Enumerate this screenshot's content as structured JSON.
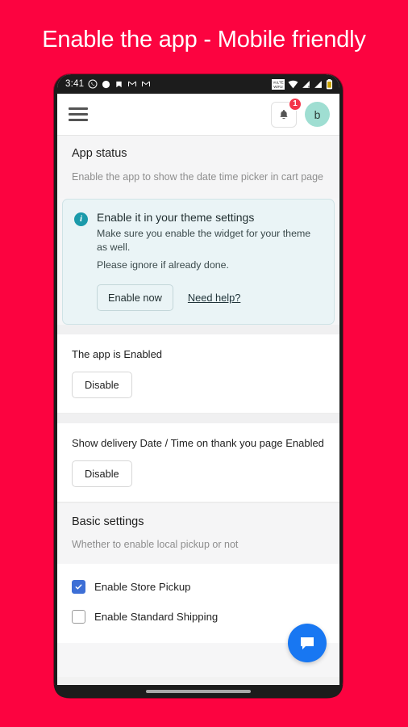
{
  "promo": {
    "title": "Enable the app - Mobile friendly",
    "background_color": "#fc0340",
    "text_color": "#ffffff"
  },
  "statusbar": {
    "time": "3:41",
    "left_icons": [
      "whatsapp-icon",
      "circle-icon",
      "bookmark-icon",
      "gmail-icon",
      "gmail-icon"
    ],
    "right_icons": [
      "volte-wifi-icon",
      "wifi-icon",
      "signal-roaming-icon",
      "signal-icon",
      "battery-icon"
    ]
  },
  "appbar": {
    "menu_icon": "hamburger-menu-icon",
    "bell_icon": "notification-bell-icon",
    "badge_count": "1",
    "avatar_initial": "b",
    "avatar_color": "#9fded2"
  },
  "app_status": {
    "heading": "App status",
    "description": "Enable the app to show the date time picker in cart page"
  },
  "info_banner": {
    "icon": "info-circle-icon",
    "icon_color": "#1b9aaa",
    "title": "Enable it in your theme settings",
    "line1": "Make sure you enable the widget for your theme as well.",
    "line2": "Please ignore if already done.",
    "primary_button": "Enable now",
    "help_link": "Need help?"
  },
  "rows": [
    {
      "label": "The app is Enabled",
      "button": "Disable"
    },
    {
      "label": "Show delivery Date / Time on thank you page Enabled",
      "button": "Disable"
    }
  ],
  "basic_settings": {
    "heading": "Basic settings",
    "description": "Whether to enable local pickup or not",
    "options": [
      {
        "label": "Enable Store Pickup",
        "checked": true
      },
      {
        "label": "Enable Standard Shipping",
        "checked": false
      }
    ],
    "checked_color": "#3d6fd6"
  },
  "chat_fab": {
    "icon": "chat-bubble-icon",
    "color": "#1877f2"
  }
}
